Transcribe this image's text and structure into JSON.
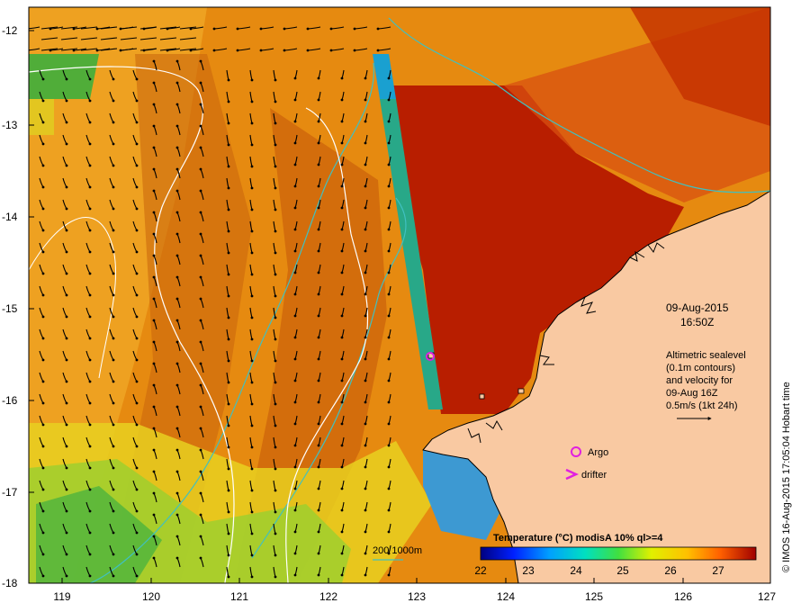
{
  "date_line1": "09-Aug-2015",
  "date_line2": "16:50Z",
  "info_lines": [
    "Altimetric sealevel",
    "(0.1m contours)",
    "and velocity for",
    "09-Aug 16Z",
    "0.5m/s (1kt 24h)"
  ],
  "legend": {
    "argo": "Argo",
    "drifter": "drifter"
  },
  "depth_contours": "200  1000m",
  "colorbar": {
    "title": "Temperature (°C) modisA 10% ql>=4",
    "ticks": [
      "22",
      "23",
      "24",
      "25",
      "26",
      "27"
    ]
  },
  "credit": "© IMOS 16-Aug-2015 17:05:04 Hobart time",
  "x_ticks": [
    "119",
    "120",
    "121",
    "122",
    "123",
    "124",
    "125",
    "126",
    "127"
  ],
  "y_ticks": [
    "-12",
    "-13",
    "-14",
    "-15",
    "-16",
    "-17",
    "-18"
  ],
  "colors": {
    "land": "#f9c9a2",
    "hot_sst": "#b61e00",
    "warm_sst": "#e78a10",
    "argo": "#e020e0"
  }
}
